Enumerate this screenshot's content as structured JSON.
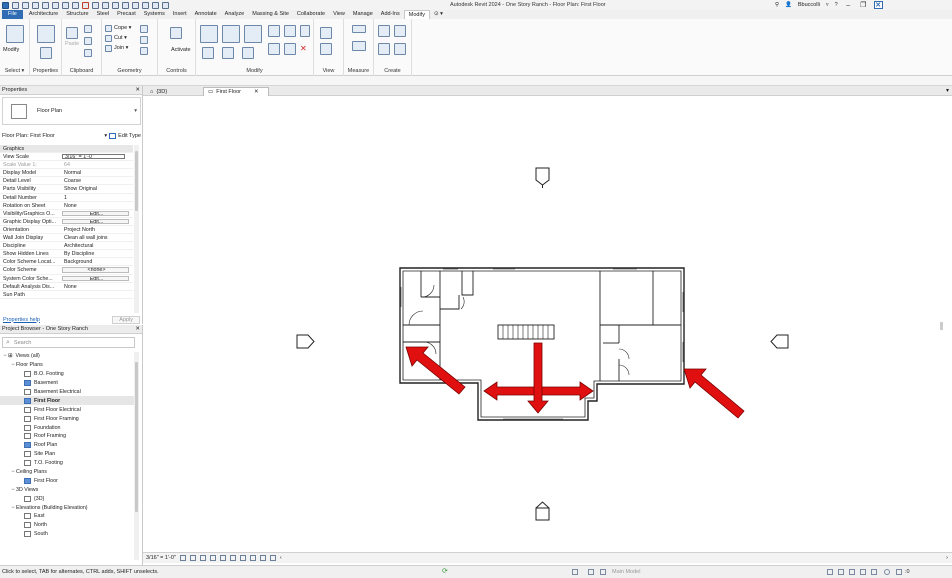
{
  "window": {
    "title": "Autodesk Revit 2024 - One Story Ranch - Floor Plan: First Floor",
    "user": "Bbuccolli",
    "help": "?"
  },
  "ribbon_tabs": [
    "File",
    "Architecture",
    "Structure",
    "Steel",
    "Precast",
    "Systems",
    "Insert",
    "Annotate",
    "Analyze",
    "Massing & Site",
    "Collaborate",
    "View",
    "Manage",
    "Add-Ins",
    "Modify"
  ],
  "ribbon": {
    "modify_label": "Modify",
    "select_label": "Select ▾",
    "properties_label": "Properties",
    "clipboard_label": "Clipboard",
    "paste_label": "Paste",
    "cope_label": "Cope ▾",
    "cut_label": "Cut ▾",
    "join_label": "Join ▾",
    "geometry_label": "Geometry",
    "activate_label": "Activate",
    "controls_label": "Controls",
    "modify_group_label": "Modify",
    "view_label": "View",
    "measure_label": "Measure",
    "create_label": "Create"
  },
  "properties": {
    "header": "Properties",
    "type_name": "Floor Plan",
    "instance": "Floor Plan: First Floor",
    "edit_type": "Edit Type",
    "rows": [
      {
        "k": "Graphics",
        "v": "",
        "hdr": true
      },
      {
        "k": "View Scale",
        "v": "3/16\" = 1'-0\"",
        "style": "input"
      },
      {
        "k": "Scale Value    1:",
        "v": "64",
        "dim": true
      },
      {
        "k": "Display Model",
        "v": "Normal"
      },
      {
        "k": "Detail Level",
        "v": "Coarse"
      },
      {
        "k": "Parts Visibility",
        "v": "Show Original"
      },
      {
        "k": "Detail Number",
        "v": "1"
      },
      {
        "k": "Rotation on Sheet",
        "v": "None"
      },
      {
        "k": "Visibility/Graphics O...",
        "v": "Edit...",
        "style": "box"
      },
      {
        "k": "Graphic Display Opti...",
        "v": "Edit...",
        "style": "box"
      },
      {
        "k": "Orientation",
        "v": "Project North"
      },
      {
        "k": "Wall Join Display",
        "v": "Clean all wall joins"
      },
      {
        "k": "Discipline",
        "v": "Architectural"
      },
      {
        "k": "Show Hidden Lines",
        "v": "By Discipline"
      },
      {
        "k": "Color Scheme Locat...",
        "v": "Background"
      },
      {
        "k": "Color Scheme",
        "v": "<none>",
        "style": "box"
      },
      {
        "k": "System Color Sche...",
        "v": "Edit...",
        "style": "box"
      },
      {
        "k": "Default Analysis Dis...",
        "v": "None"
      },
      {
        "k": "Sun Path",
        "v": ""
      }
    ],
    "help_link": "Properties help",
    "apply": "Apply"
  },
  "browser": {
    "header": "Project Browser - One Story Ranch",
    "search_placeholder": "Search",
    "items": [
      {
        "label": "Views (all)",
        "level": 0,
        "toggle": "−",
        "icon": "views"
      },
      {
        "label": "Floor Plans",
        "level": 1,
        "toggle": "−"
      },
      {
        "label": "B.O. Footing",
        "level": 2,
        "icon": "plain"
      },
      {
        "label": "Basement",
        "level": 2,
        "icon": "blue"
      },
      {
        "label": "Basement Electrical",
        "level": 2,
        "icon": "plain"
      },
      {
        "label": "First Floor",
        "level": 2,
        "icon": "blue",
        "selected": true
      },
      {
        "label": "First Floor Electrical",
        "level": 2,
        "icon": "plain"
      },
      {
        "label": "First Floor Framing",
        "level": 2,
        "icon": "plain"
      },
      {
        "label": "Foundation",
        "level": 2,
        "icon": "plain"
      },
      {
        "label": "Roof Framing",
        "level": 2,
        "icon": "plain"
      },
      {
        "label": "Roof Plan",
        "level": 2,
        "icon": "blue"
      },
      {
        "label": "Site Plan",
        "level": 2,
        "icon": "plain"
      },
      {
        "label": "T.O. Footing",
        "level": 2,
        "icon": "plain"
      },
      {
        "label": "Ceiling Plans",
        "level": 1,
        "toggle": "−"
      },
      {
        "label": "First Floor",
        "level": 2,
        "icon": "blue"
      },
      {
        "label": "3D Views",
        "level": 1,
        "toggle": "−"
      },
      {
        "label": "{3D}",
        "level": 2,
        "icon": "plain"
      },
      {
        "label": "Elevations (Building Elevation)",
        "level": 1,
        "toggle": "−"
      },
      {
        "label": "East",
        "level": 2,
        "icon": "plain"
      },
      {
        "label": "North",
        "level": 2,
        "icon": "plain"
      },
      {
        "label": "South",
        "level": 2,
        "icon": "plain"
      }
    ]
  },
  "view_tabs": [
    {
      "label": "{3D}",
      "active": false
    },
    {
      "label": "First Floor",
      "active": true
    }
  ],
  "view_control": {
    "scale": "3/16\" = 1'-0\""
  },
  "status": {
    "message": "Click to select, TAB for alternates, CTRL adds, SHIFT unselects.",
    "model": "Main Model",
    "filter_count": ":0"
  },
  "colors": {
    "accent": "#2f6cb3",
    "arrow": "#e01010"
  }
}
